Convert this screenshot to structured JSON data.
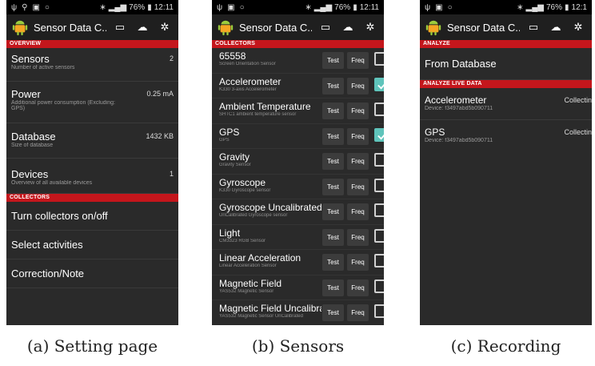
{
  "status_bar": {
    "battery": "76%",
    "time_a": "12:11",
    "time_b": "12:11",
    "time_c": "12:1"
  },
  "app": {
    "title": "Sensor Data C..."
  },
  "screen_a": {
    "overview_header": "OVERVIEW",
    "items": [
      {
        "title": "Sensors",
        "subtitle": "Number of active sensors",
        "value": "2"
      },
      {
        "title": "Power",
        "subtitle": "Additional power consumption (Excluding: GPS)",
        "value": "0.25 mA"
      },
      {
        "title": "Database",
        "subtitle": "Size of database",
        "value": "1432 KB"
      },
      {
        "title": "Devices",
        "subtitle": "Overview of all available devices",
        "value": "1"
      }
    ],
    "collectors_header": "COLLECTORS",
    "actions": [
      "Turn collectors on/off",
      "Select activities",
      "Correction/Note"
    ]
  },
  "screen_b": {
    "collectors_header": "COLLECTORS",
    "test_label": "Test",
    "freq_label": "Freq",
    "sensors": [
      {
        "name": "65558",
        "sub": "Screen Orientation Sensor",
        "checked": false
      },
      {
        "name": "Accelerometer",
        "sub": "K330 3-axis Accelerometer",
        "checked": true
      },
      {
        "name": "Ambient Temperature",
        "sub": "SHTC1 ambient temperature sensor",
        "checked": false
      },
      {
        "name": "GPS",
        "sub": "GPS",
        "checked": true
      },
      {
        "name": "Gravity",
        "sub": "Gravity Sensor",
        "checked": false
      },
      {
        "name": "Gyroscope",
        "sub": "K330 Gyroscope sensor",
        "checked": false
      },
      {
        "name": "Gyroscope Uncalibrated",
        "sub": "UnCalibrated Gyroscope sensor",
        "checked": false
      },
      {
        "name": "Light",
        "sub": "CM3323 RGB Sensor",
        "checked": false
      },
      {
        "name": "Linear Acceleration",
        "sub": "Linear Acceleration Sensor",
        "checked": false
      },
      {
        "name": "Magnetic Field",
        "sub": "YAS532 Magnetic Sensor",
        "checked": false
      },
      {
        "name": "Magnetic Field Uncalibrated",
        "sub": "YAS532 Magnetic Sensor UnCalibrated",
        "checked": false
      }
    ]
  },
  "screen_c": {
    "analyze_header": "ANALYZE",
    "from_database": "From Database",
    "live_header": "ANALYZE LIVE DATA",
    "live": [
      {
        "title": "Accelerometer",
        "sub": "Device: f3497abd5b090711",
        "status": "Collectin"
      },
      {
        "title": "GPS",
        "sub": "Device: f3497abd5b090711",
        "status": "Collectin"
      }
    ]
  },
  "captions": [
    "(a) Setting page",
    "(b) Sensors",
    "(c) Recording"
  ]
}
